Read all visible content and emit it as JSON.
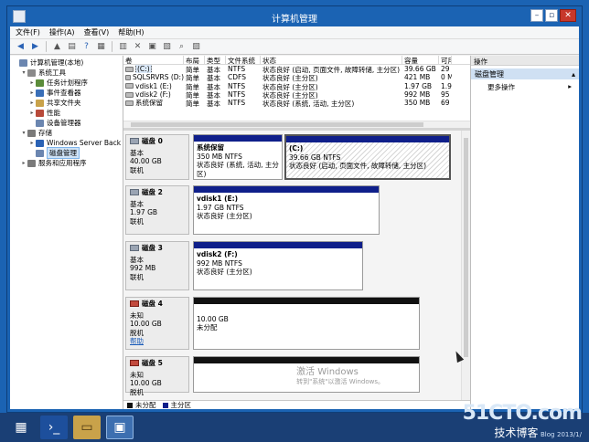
{
  "window": {
    "title": "计算机管理"
  },
  "menu": [
    "文件(F)",
    "操作(A)",
    "查看(V)",
    "帮助(H)"
  ],
  "toolbar_icons": [
    "back-icon",
    "forward-icon",
    "up-icon",
    "console-tree-icon",
    "help-icon",
    "properties-icon",
    "export-icon",
    "delete-icon",
    "connect-icon",
    "open-icon",
    "search-icon",
    "settings-icon"
  ],
  "tree": [
    {
      "label": "计算机管理(本地)",
      "level": 0,
      "exp": ""
    },
    {
      "label": "系统工具",
      "level": 1,
      "exp": "▾"
    },
    {
      "label": "任务计划程序",
      "level": 2,
      "exp": "▸"
    },
    {
      "label": "事件查看器",
      "level": 2,
      "exp": "▸"
    },
    {
      "label": "共享文件夹",
      "level": 2,
      "exp": "▸"
    },
    {
      "label": "性能",
      "level": 2,
      "exp": "▸"
    },
    {
      "label": "设备管理器",
      "level": 2,
      "exp": ""
    },
    {
      "label": "存储",
      "level": 1,
      "exp": "▾"
    },
    {
      "label": "Windows Server Back",
      "level": 2,
      "exp": "▸"
    },
    {
      "label": "磁盘管理",
      "level": 2,
      "exp": "",
      "selected": true
    },
    {
      "label": "服务和应用程序",
      "level": 1,
      "exp": "▸"
    }
  ],
  "volume_columns": [
    "卷",
    "布局",
    "类型",
    "文件系统",
    "状态",
    "容量",
    "可用"
  ],
  "volumes": [
    {
      "name": "(C:)",
      "layout": "简单",
      "type": "基本",
      "fs": "NTFS",
      "status": "状态良好 (启动, 页面文件, 故障转储, 主分区)",
      "capacity": "39.66 GB",
      "free": "29",
      "selected": true
    },
    {
      "name": "SQLSRVRS (D:)",
      "layout": "简单",
      "type": "基本",
      "fs": "CDFS",
      "status": "状态良好 (主分区)",
      "capacity": "421 MB",
      "free": "0 M"
    },
    {
      "name": "vdisk1 (E:)",
      "layout": "简单",
      "type": "基本",
      "fs": "NTFS",
      "status": "状态良好 (主分区)",
      "capacity": "1.97 GB",
      "free": "1.9"
    },
    {
      "name": "vdisk2 (F:)",
      "layout": "简单",
      "type": "基本",
      "fs": "NTFS",
      "status": "状态良好 (主分区)",
      "capacity": "992 MB",
      "free": "95"
    },
    {
      "name": "系统保留",
      "layout": "简单",
      "type": "基本",
      "fs": "NTFS",
      "status": "状态良好 (系统, 活动, 主分区)",
      "capacity": "350 MB",
      "free": "69"
    }
  ],
  "disks": [
    {
      "name": "磁盘 0",
      "type": "基本",
      "size": "40.00 GB",
      "status": "联机",
      "partitions": [
        {
          "title": "系统保留",
          "size": "350 MB NTFS",
          "status": "状态良好 (系统, 活动, 主分区)"
        },
        {
          "title": "(C:)",
          "size": "39.66 GB NTFS",
          "status": "状态良好 (启动, 页面文件, 故障转储, 主分区)"
        }
      ]
    },
    {
      "name": "磁盘 2",
      "type": "基本",
      "size": "1.97 GB",
      "status": "联机",
      "partitions": [
        {
          "title": "vdisk1 (E:)",
          "size": "1.97 GB NTFS",
          "status": "状态良好 (主分区)"
        }
      ]
    },
    {
      "name": "磁盘 3",
      "type": "基本",
      "size": "992 MB",
      "status": "联机",
      "partitions": [
        {
          "title": "vdisk2 (F:)",
          "size": "992 MB NTFS",
          "status": "状态良好 (主分区)"
        }
      ]
    },
    {
      "name": "磁盘 4",
      "type": "未知",
      "size": "10.00 GB",
      "status": "脱机",
      "help": "帮助",
      "partitions": [
        {
          "title": "",
          "size": "10.00 GB",
          "status": "未分配"
        }
      ]
    },
    {
      "name": "磁盘 5",
      "type": "未知",
      "size": "10.00 GB",
      "status": "脱机",
      "partitions": [
        {
          "title": "",
          "size": "",
          "status": ""
        }
      ]
    }
  ],
  "legend": {
    "unallocated": "未分配",
    "primary": "主分区"
  },
  "actions": {
    "header": "操作",
    "selected": "磁盘管理",
    "more": "更多操作"
  },
  "watermark": {
    "line1": "激活 Windows",
    "line2": "转到\"系统\"以激活 Windows。"
  },
  "branding": {
    "logo": "51CTO.com",
    "sub": "技术博客",
    "blog": "Blog",
    "date": "2013/1/"
  },
  "colors": {
    "primary_partition": "#0f1f8a",
    "unallocated": "#111111",
    "title_bar": "#1b63b3",
    "taskbar": "#1a3f75"
  }
}
